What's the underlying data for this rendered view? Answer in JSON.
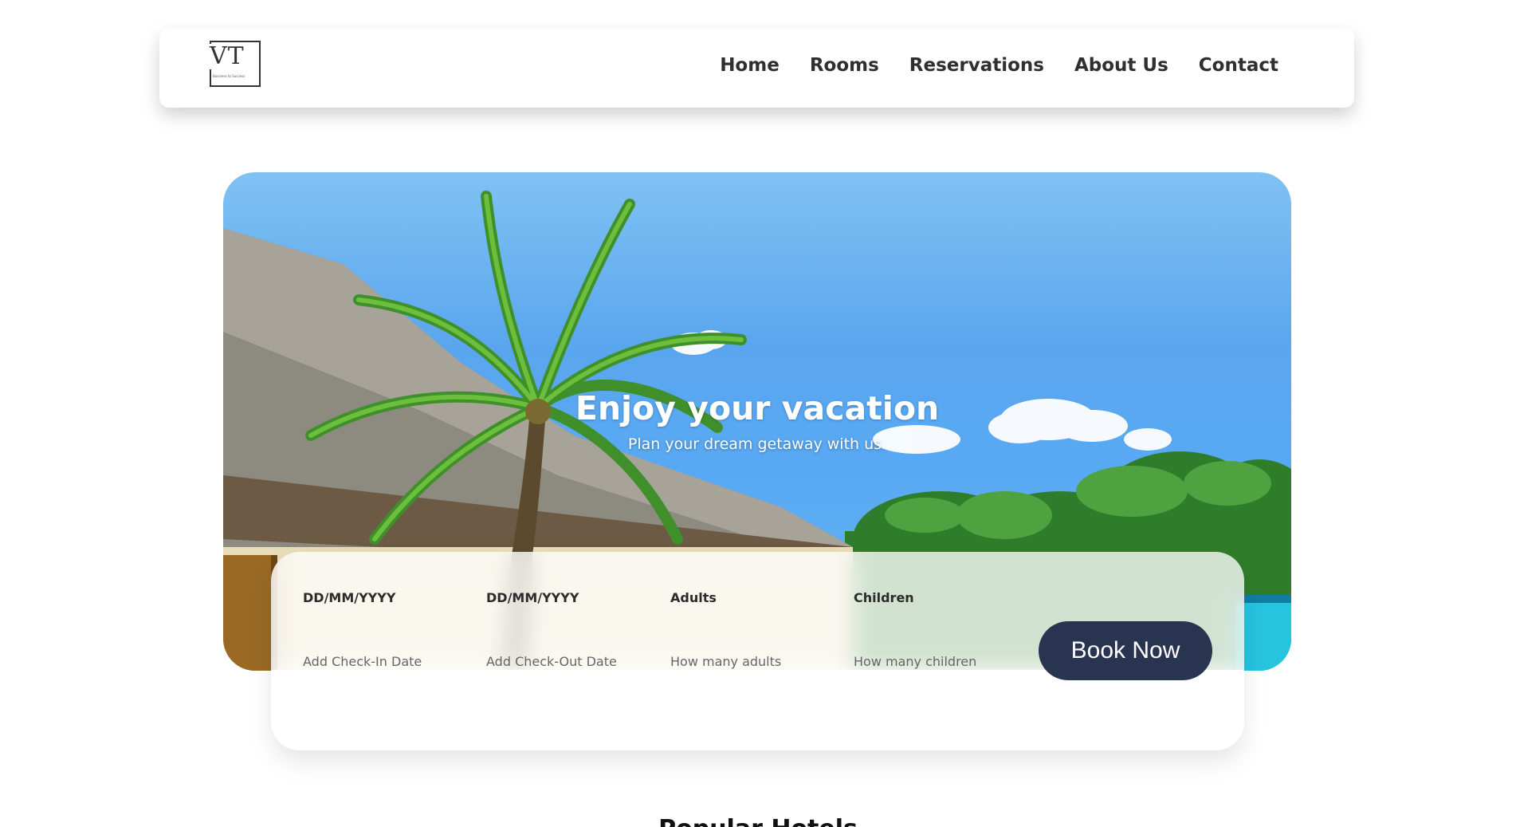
{
  "header": {
    "logo": {
      "text": "VT",
      "tagline": "Business to Success"
    },
    "nav": [
      {
        "label": "Home"
      },
      {
        "label": "Rooms"
      },
      {
        "label": "Reservations"
      },
      {
        "label": "About Us"
      },
      {
        "label": "Contact"
      }
    ]
  },
  "hero": {
    "title": "Enjoy your vacation",
    "subtitle": "Plan your dream getaway with us."
  },
  "booking": {
    "fields": [
      {
        "label": "DD/MM/YYYY",
        "placeholder": "Add Check-In Date"
      },
      {
        "label": "DD/MM/YYYY",
        "placeholder": "Add Check-Out Date"
      },
      {
        "label": "Adults",
        "placeholder": "How many adults"
      },
      {
        "label": "Children",
        "placeholder": "How many children"
      }
    ],
    "button_label": "Book Now"
  },
  "popular": {
    "title": "Popular Hotels"
  },
  "colors": {
    "button": "#293450",
    "text_dark": "#2f2f2f",
    "sky": "#58a9f4"
  }
}
